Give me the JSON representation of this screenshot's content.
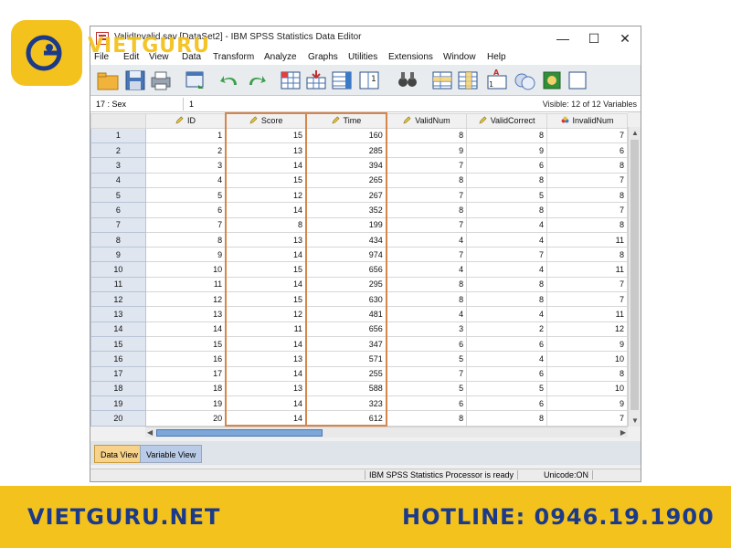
{
  "brand": {
    "logo_text": "VIETGURU",
    "color": "#f4c21c"
  },
  "window": {
    "title": "ValidInvalid.sav [DataSet2] - IBM SPSS Statistics Data Editor",
    "minimize": "—",
    "maximize": "☐",
    "close": "✕"
  },
  "menu": [
    "File",
    "Edit",
    "View",
    "Data",
    "Transform",
    "Analyze",
    "Graphs",
    "Utilities",
    "Extensions",
    "Window",
    "Help"
  ],
  "toolbar_icons": [
    "open-folder-icon",
    "save-icon",
    "print-icon",
    "dialog-recall-icon",
    "undo-icon",
    "redo-icon",
    "goto-case-icon",
    "goto-variable-icon",
    "variables-icon",
    "run-descriptives-icon",
    "find-icon",
    "insert-cases-icon",
    "insert-variable-icon",
    "split-file-icon",
    "value-labels-icon",
    "use-sets-icon",
    "show-all-variables-icon"
  ],
  "cellbar": {
    "ref": "17 : Sex",
    "value": "1",
    "visible": "Visible: 12 of 12 Variables"
  },
  "grid": {
    "columns": [
      "ID",
      "Score",
      "Time",
      "ValidNum",
      "ValidCorrect",
      "InvalidNum"
    ],
    "rows": [
      [
        "1",
        "1",
        "15",
        "160",
        "8",
        "8",
        "7"
      ],
      [
        "2",
        "2",
        "13",
        "285",
        "9",
        "9",
        "6"
      ],
      [
        "3",
        "3",
        "14",
        "394",
        "7",
        "6",
        "8"
      ],
      [
        "4",
        "4",
        "15",
        "265",
        "8",
        "8",
        "7"
      ],
      [
        "5",
        "5",
        "12",
        "267",
        "7",
        "5",
        "8"
      ],
      [
        "6",
        "6",
        "14",
        "352",
        "8",
        "8",
        "7"
      ],
      [
        "7",
        "7",
        "8",
        "199",
        "7",
        "4",
        "8"
      ],
      [
        "8",
        "8",
        "13",
        "434",
        "4",
        "4",
        "11"
      ],
      [
        "9",
        "9",
        "14",
        "974",
        "7",
        "7",
        "8"
      ],
      [
        "10",
        "10",
        "15",
        "656",
        "4",
        "4",
        "11"
      ],
      [
        "11",
        "11",
        "14",
        "295",
        "8",
        "8",
        "7"
      ],
      [
        "12",
        "12",
        "15",
        "630",
        "8",
        "8",
        "7"
      ],
      [
        "13",
        "13",
        "12",
        "481",
        "4",
        "4",
        "11"
      ],
      [
        "14",
        "14",
        "11",
        "656",
        "3",
        "2",
        "12"
      ],
      [
        "15",
        "15",
        "14",
        "347",
        "6",
        "6",
        "9"
      ],
      [
        "16",
        "16",
        "13",
        "571",
        "5",
        "4",
        "10"
      ],
      [
        "17",
        "17",
        "14",
        "255",
        "7",
        "6",
        "8"
      ],
      [
        "18",
        "18",
        "13",
        "588",
        "5",
        "5",
        "10"
      ],
      [
        "19",
        "19",
        "14",
        "323",
        "6",
        "6",
        "9"
      ],
      [
        "20",
        "20",
        "14",
        "612",
        "8",
        "8",
        "7"
      ]
    ]
  },
  "tabs": {
    "data_view": "Data View",
    "variable_view": "Variable View"
  },
  "status": {
    "processor": "IBM SPSS Statistics Processor is ready",
    "unicode": "Unicode:ON"
  },
  "footer": {
    "site": "VIETGURU.NET",
    "hotline": "HOTLINE: 0946.19.1900"
  },
  "colors": {
    "highlight": "#d4864b",
    "footer_bg": "#f4c21c",
    "footer_text": "#1b3a8a"
  }
}
